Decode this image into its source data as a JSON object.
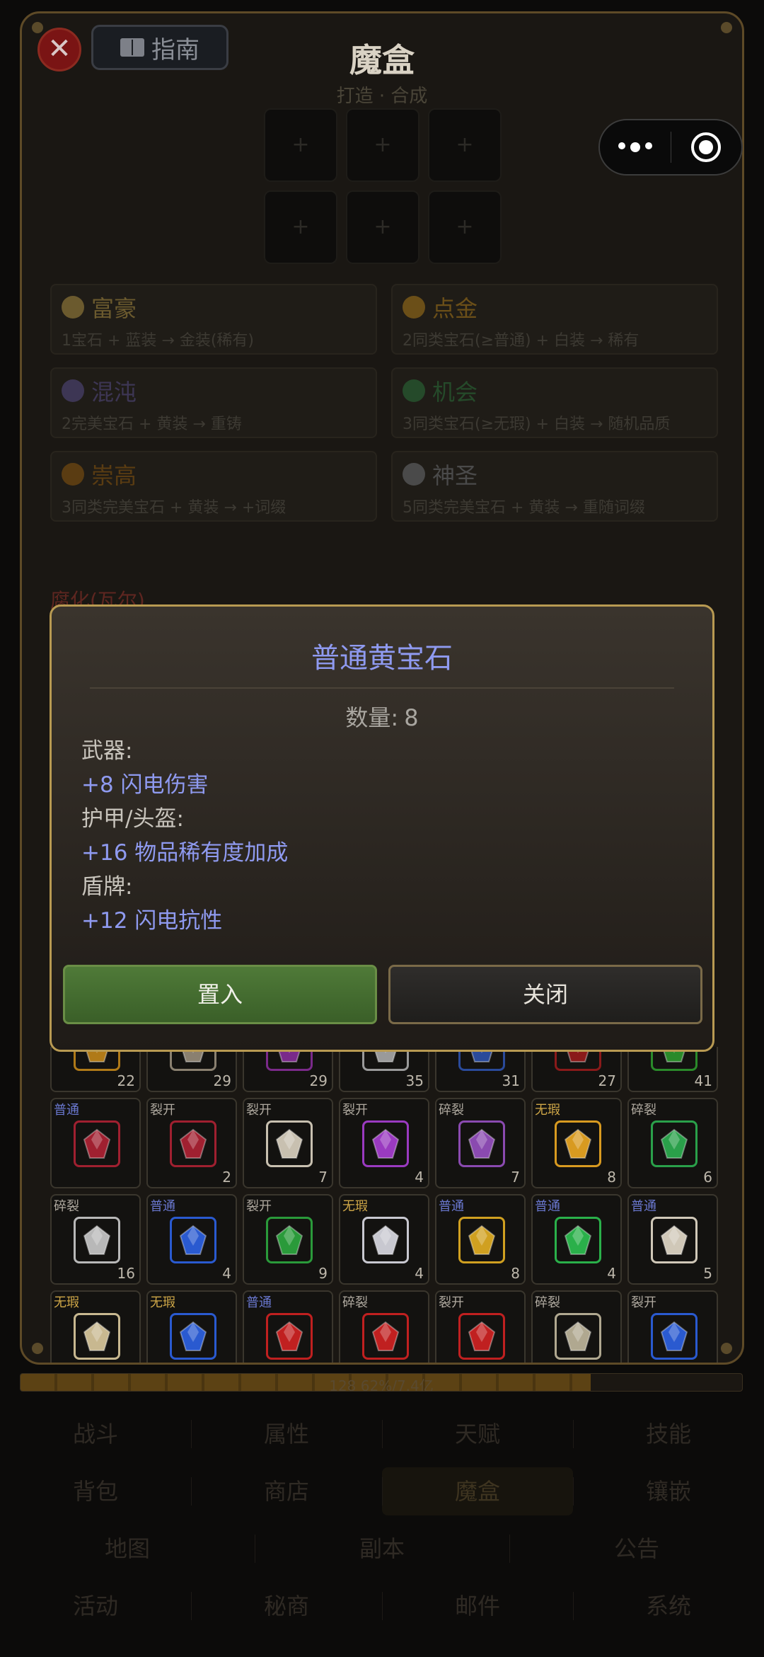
{
  "panel": {
    "title": "魔盒",
    "subtitle": "打造 · 合成",
    "guide_label": "指南",
    "close_symbol": "✕",
    "craft_slot_symbol": "+",
    "corrupt_label": "腐化(瓦尔)"
  },
  "recipes": [
    {
      "name": "富豪",
      "desc": "1宝石 + 蓝装 → 金装(稀有)",
      "icon": "money-bag-icon",
      "color": "#6b5a2e"
    },
    {
      "name": "点金",
      "desc": "2同类宝石(≥普通) + 白装 → 稀有",
      "icon": "gold-orb-icon",
      "color": "#6b4f18"
    },
    {
      "name": "混沌",
      "desc": "2完美宝石 + 黄装 → 重铸",
      "icon": "chaos-orb-icon",
      "color": "#3d3654"
    },
    {
      "name": "机会",
      "desc": "3同类宝石(≥无瑕) + 白装 → 随机品质",
      "icon": "chance-orb-icon",
      "color": "#254a2a"
    },
    {
      "name": "崇高",
      "desc": "3同类完美宝石 + 黄装 → +词缀",
      "icon": "exalted-orb-icon",
      "color": "#5a3c12"
    },
    {
      "name": "神圣",
      "desc": "5同类完美宝石 + 黄装 → 重随词缀",
      "icon": "divine-orb-icon",
      "color": "#4a4a4a"
    }
  ],
  "inventory": {
    "partial_row_counts": [
      "22",
      "29",
      "29",
      "35",
      "31",
      "27",
      "41"
    ],
    "partial_row_colors": [
      "#b07a18",
      "#8a8070",
      "#7a2a8a",
      "#9a9a9a",
      "#2a4a9a",
      "#8a1a1a",
      "#2a8a2a"
    ],
    "rows": [
      [
        {
          "tag": "普通",
          "tag_color": "#6a78d0",
          "count": "",
          "icon": "red-diamond-icon",
          "color": "#a02030"
        },
        {
          "tag": "裂开",
          "tag_color": "#b0aaa0",
          "count": "2",
          "icon": "red-diamond-icon",
          "color": "#a02030"
        },
        {
          "tag": "裂开",
          "tag_color": "#b0aaa0",
          "count": "7",
          "icon": "skull-icon",
          "color": "#c8c0b0"
        },
        {
          "tag": "裂开",
          "tag_color": "#b0aaa0",
          "count": "4",
          "icon": "amethyst-icon",
          "color": "#9a3ac0"
        },
        {
          "tag": "碎裂",
          "tag_color": "#b0aaa0",
          "count": "7",
          "icon": "amethyst-icon",
          "color": "#8a4ab0"
        },
        {
          "tag": "无瑕",
          "tag_color": "#d0a848",
          "count": "8",
          "icon": "topaz-icon",
          "color": "#d89a20"
        },
        {
          "tag": "碎裂",
          "tag_color": "#b0aaa0",
          "count": "6",
          "icon": "emerald-icon",
          "color": "#2aa04a"
        }
      ],
      [
        {
          "tag": "碎裂",
          "tag_color": "#b0aaa0",
          "count": "16",
          "icon": "diamond-icon",
          "color": "#b8b8b8"
        },
        {
          "tag": "普通",
          "tag_color": "#6a78d0",
          "count": "4",
          "icon": "sapphire-icon",
          "color": "#2a5ad0"
        },
        {
          "tag": "裂开",
          "tag_color": "#b0aaa0",
          "count": "9",
          "icon": "emerald-icon",
          "color": "#2a9a3a"
        },
        {
          "tag": "无瑕",
          "tag_color": "#d0a848",
          "count": "4",
          "icon": "diamond-icon",
          "color": "#c8c8d0"
        },
        {
          "tag": "普通",
          "tag_color": "#6a78d0",
          "count": "8",
          "icon": "topaz-icon",
          "color": "#d0a020"
        },
        {
          "tag": "普通",
          "tag_color": "#6a78d0",
          "count": "4",
          "icon": "emerald-icon",
          "color": "#2ab04a"
        },
        {
          "tag": "普通",
          "tag_color": "#6a78d0",
          "count": "5",
          "icon": "skull-icon",
          "color": "#d0c8b8"
        }
      ],
      [
        {
          "tag": "无瑕",
          "tag_color": "#d0a848",
          "count": "",
          "icon": "skull-icon",
          "color": "#c8b890"
        },
        {
          "tag": "无瑕",
          "tag_color": "#d0a848",
          "count": "",
          "icon": "sapphire-icon",
          "color": "#2a5ad0"
        },
        {
          "tag": "普通",
          "tag_color": "#6a78d0",
          "count": "",
          "icon": "ruby-icon",
          "color": "#c02020"
        },
        {
          "tag": "碎裂",
          "tag_color": "#b0aaa0",
          "count": "",
          "icon": "ruby-icon",
          "color": "#c02020"
        },
        {
          "tag": "裂开",
          "tag_color": "#b0aaa0",
          "count": "",
          "icon": "ruby-icon",
          "color": "#c02020"
        },
        {
          "tag": "碎裂",
          "tag_color": "#b0aaa0",
          "count": "",
          "icon": "skull-icon",
          "color": "#b0a890"
        },
        {
          "tag": "裂开",
          "tag_color": "#b0aaa0",
          "count": "",
          "icon": "sapphire-icon",
          "color": "#2a5ad0"
        }
      ]
    ]
  },
  "xp": {
    "text": "128 62%/7.4亿",
    "fraction": 0.79
  },
  "nav": {
    "rows": [
      [
        "战斗",
        "属性",
        "天赋",
        "技能"
      ],
      [
        "背包",
        "商店",
        "魔盒",
        "镶嵌"
      ],
      [
        "地图",
        "副本",
        "公告"
      ],
      [
        "活动",
        "秘商",
        "邮件",
        "系统"
      ]
    ],
    "active": "魔盒"
  },
  "modal": {
    "title": "普通黄宝石",
    "qty_label": "数量:",
    "qty_value": "8",
    "stats": [
      {
        "category": "武器:",
        "value": "+8 闪电伤害"
      },
      {
        "category": "护甲/头盔:",
        "value": "+16 物品稀有度加成"
      },
      {
        "category": "盾牌:",
        "value": "+12 闪电抗性"
      }
    ],
    "place_label": "置入",
    "close_label": "关闭"
  },
  "colors": {
    "accent_gold": "#b89a52",
    "stat_blue": "#8f9af0",
    "place_green": "#4f7a38"
  }
}
